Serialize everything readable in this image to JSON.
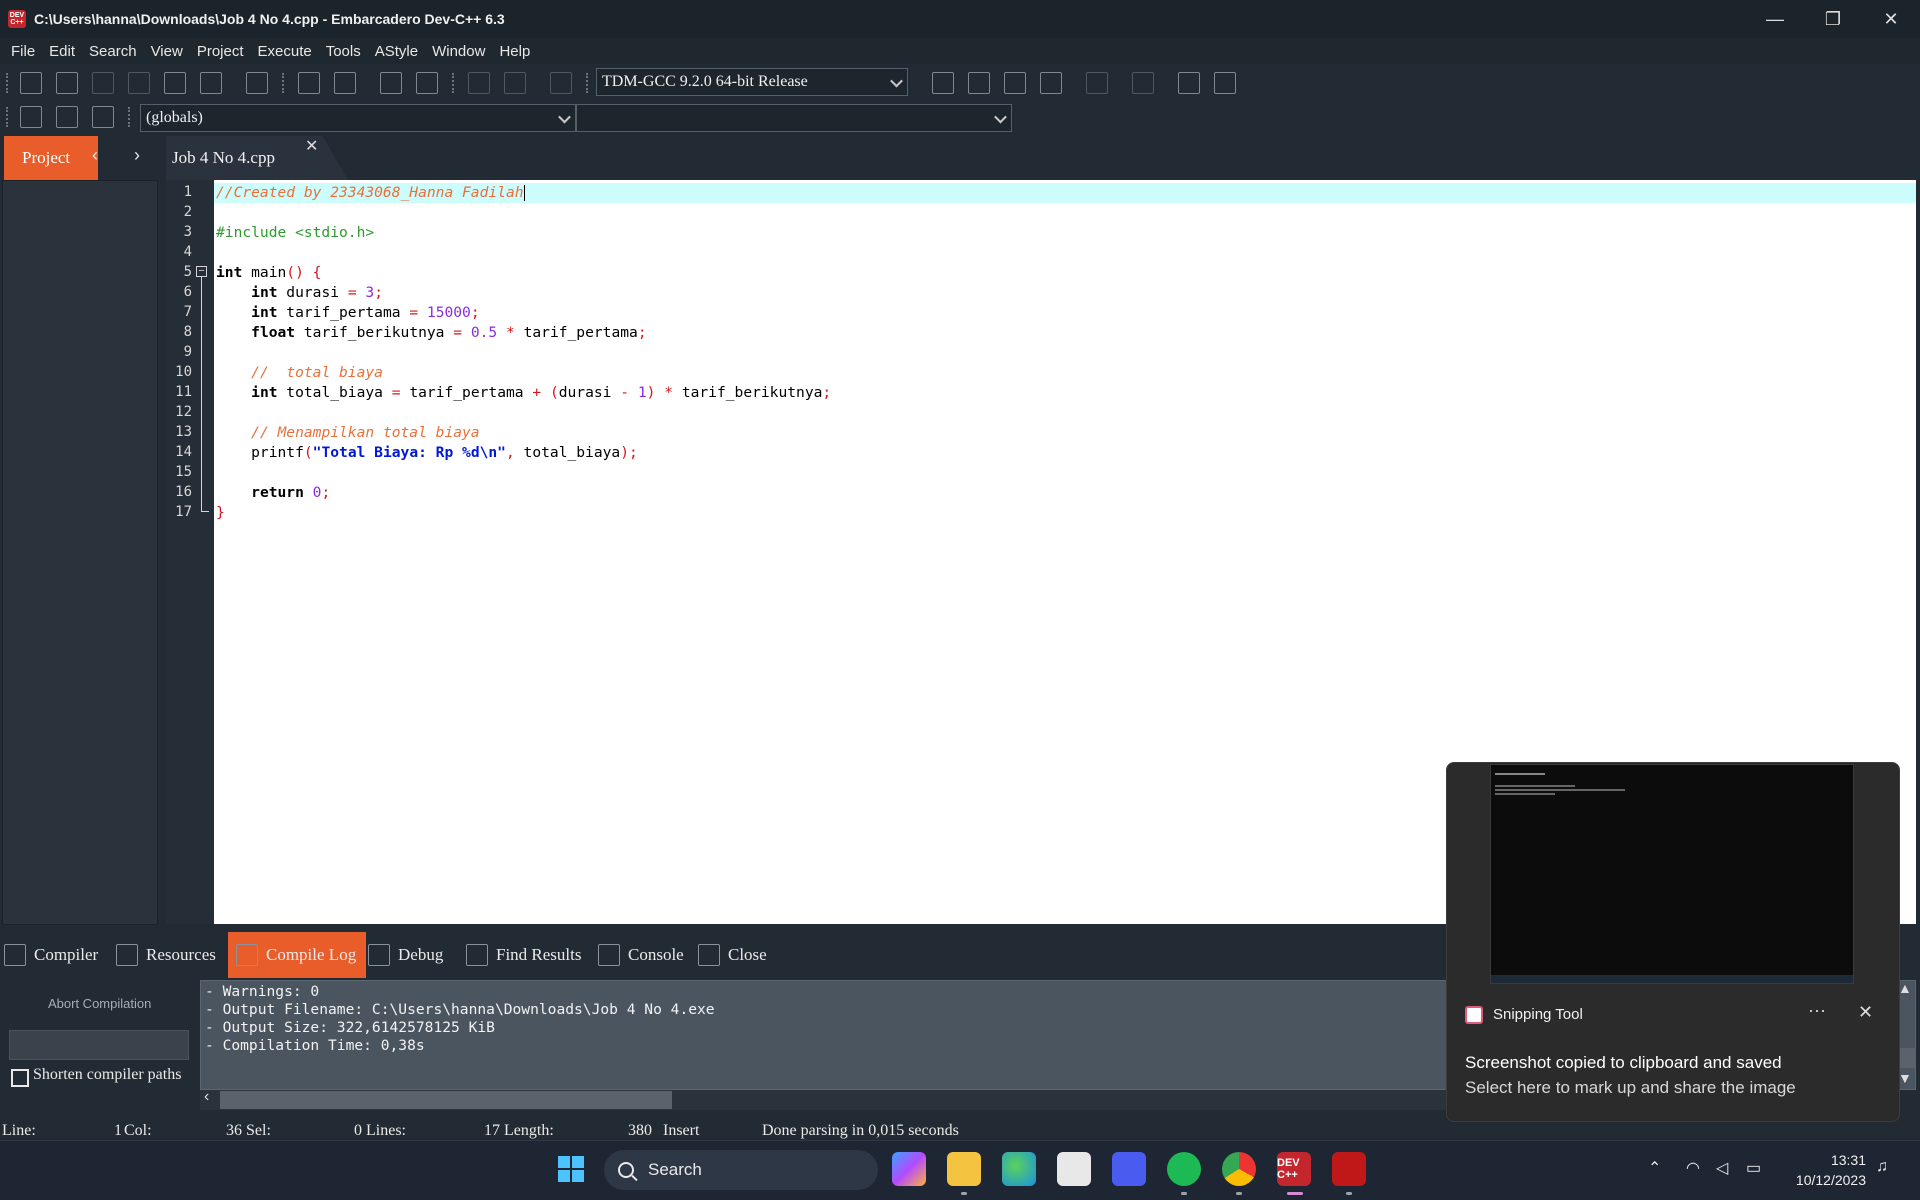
{
  "window": {
    "title": "C:\\Users\\hanna\\Downloads\\Job 4 No 4.cpp - Embarcadero Dev-C++ 6.3",
    "icon_text": "DEV C++",
    "minimize": "—",
    "restore": "❐",
    "close": "✕"
  },
  "menu": [
    "File",
    "Edit",
    "Search",
    "View",
    "Project",
    "Execute",
    "Tools",
    "AStyle",
    "Window",
    "Help"
  ],
  "toolbar": {
    "compiler_select": "TDM-GCC 9.2.0 64-bit Release",
    "scope_select": "(globals)",
    "function_select": ""
  },
  "left_panel": {
    "project_tab": "Project",
    "prev": "‹",
    "next": "›"
  },
  "editor": {
    "file_tab": "Job 4 No 4.cpp",
    "file_tab_close": "✕",
    "line_numbers": [
      "1",
      "2",
      "3",
      "4",
      "5",
      "6",
      "7",
      "8",
      "9",
      "10",
      "11",
      "12",
      "13",
      "14",
      "15",
      "16",
      "17"
    ]
  },
  "bottom_panel": {
    "tabs": [
      "Compiler",
      "Resources",
      "Compile Log",
      "Debug",
      "Find Results",
      "Console",
      "Close"
    ],
    "active_tab": "Compile Log",
    "abort_label": "Abort Compilation",
    "shorten_label": "Shorten compiler paths",
    "log_lines": [
      "- Warnings: 0",
      "- Output Filename: C:\\Users\\hanna\\Downloads\\Job 4 No 4.exe",
      "- Output Size: 322,6142578125 KiB",
      "- Compilation Time: 0,38s"
    ]
  },
  "status": {
    "line_label": "Line:",
    "line": "1",
    "col_label": "Col:",
    "col": "36",
    "sel_label": "Sel:",
    "sel": "0",
    "lines_label": "Lines:",
    "lines": "17",
    "length_label": "Length:",
    "length": "380",
    "mode": "Insert",
    "message": "Done parsing in 0,015 seconds"
  },
  "toast": {
    "app": "Snipping Tool",
    "more": "···",
    "close": "✕",
    "title": "Screenshot copied to clipboard and saved",
    "body": "Select here to mark up and share the image"
  },
  "taskbar": {
    "search": "Search",
    "time": "13:31",
    "date": "10/12/2023",
    "dev_label": "DEV C++"
  },
  "colors": {
    "accent": "#e85d2a",
    "comment": "#e8703a",
    "preprocessor": "#2e9a2e",
    "number": "#8a2be2",
    "operator": "#d4161b",
    "string": "#0018d8",
    "current_line": "#cdfcfd"
  }
}
